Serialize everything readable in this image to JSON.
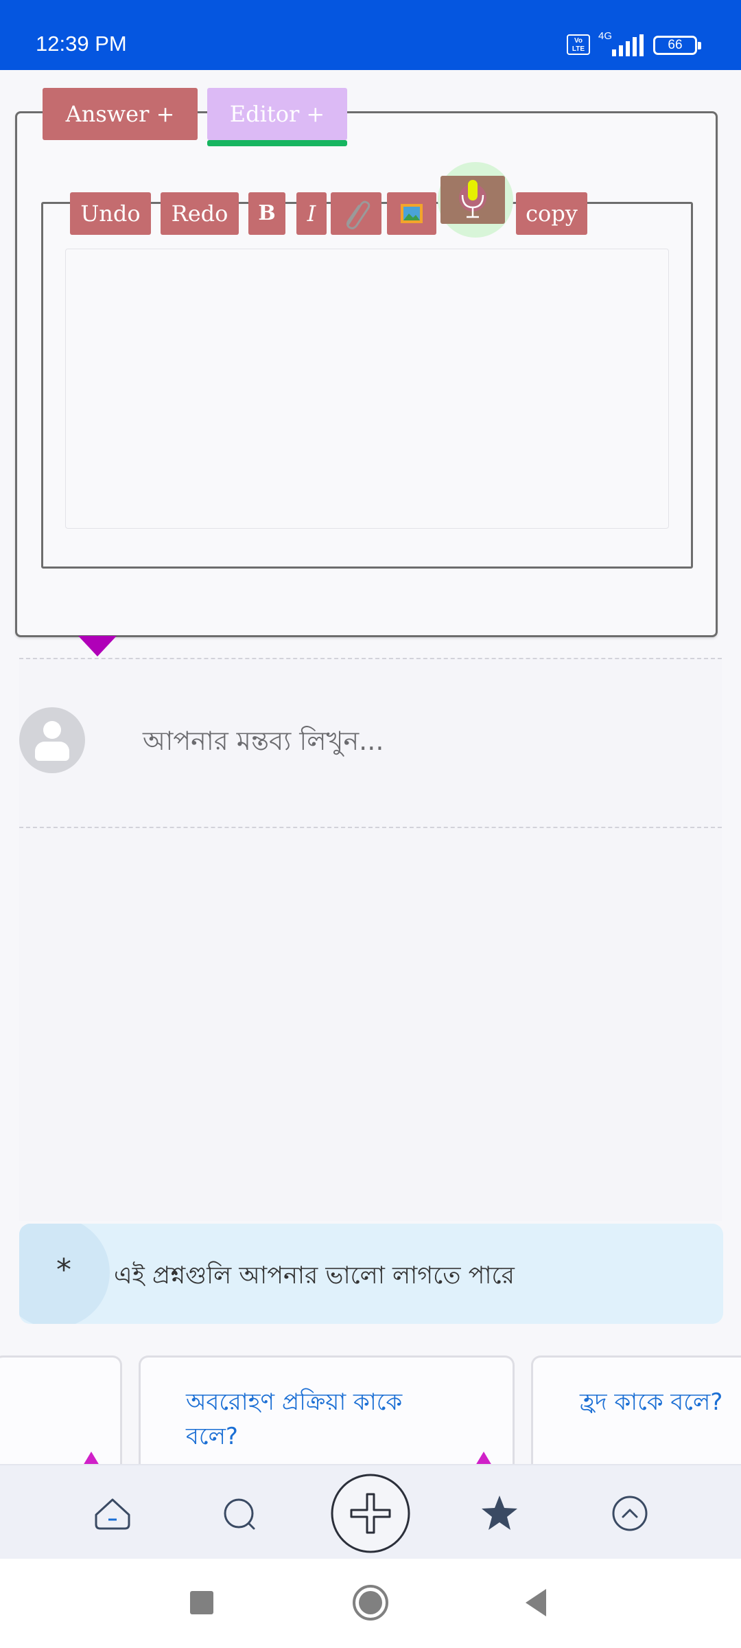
{
  "status_bar": {
    "time": "12:39 PM",
    "volte": "Vo LTE",
    "network": "4G",
    "battery": "66"
  },
  "tabs": {
    "answer_label": "Answer +",
    "editor_label": "Editor +"
  },
  "toolbar": {
    "undo_label": "Undo",
    "redo_label": "Redo",
    "bold_label": "B",
    "italic_label": "I",
    "copy_label": "copy"
  },
  "editor": {
    "content": ""
  },
  "comment": {
    "placeholder": "আপনার মন্তব্য লিখুন..."
  },
  "suggestions": {
    "icon": "*",
    "heading": "এই প্রশ্নগুলি আপনার ভালো লাগতে পারে",
    "cards": [
      {
        "title": ""
      },
      {
        "title": "অবরোহণ প্রক্রিয়া কাকে বলে?"
      },
      {
        "title": "হ্রদ কাকে বলে?"
      }
    ]
  },
  "bottom_nav": {
    "icons": [
      "home-icon",
      "search-icon",
      "add-icon",
      "star-icon",
      "scroll-up-icon"
    ]
  },
  "colors": {
    "status_bar": "#0556e0",
    "tab_answer": "#c46c6f",
    "tab_editor": "#dcbaf5",
    "tab_active_underline": "#17b560",
    "toolbar_button": "#c46c6f",
    "link_text": "#1a6ed4",
    "suggest_bg": "#e0f1fb"
  }
}
